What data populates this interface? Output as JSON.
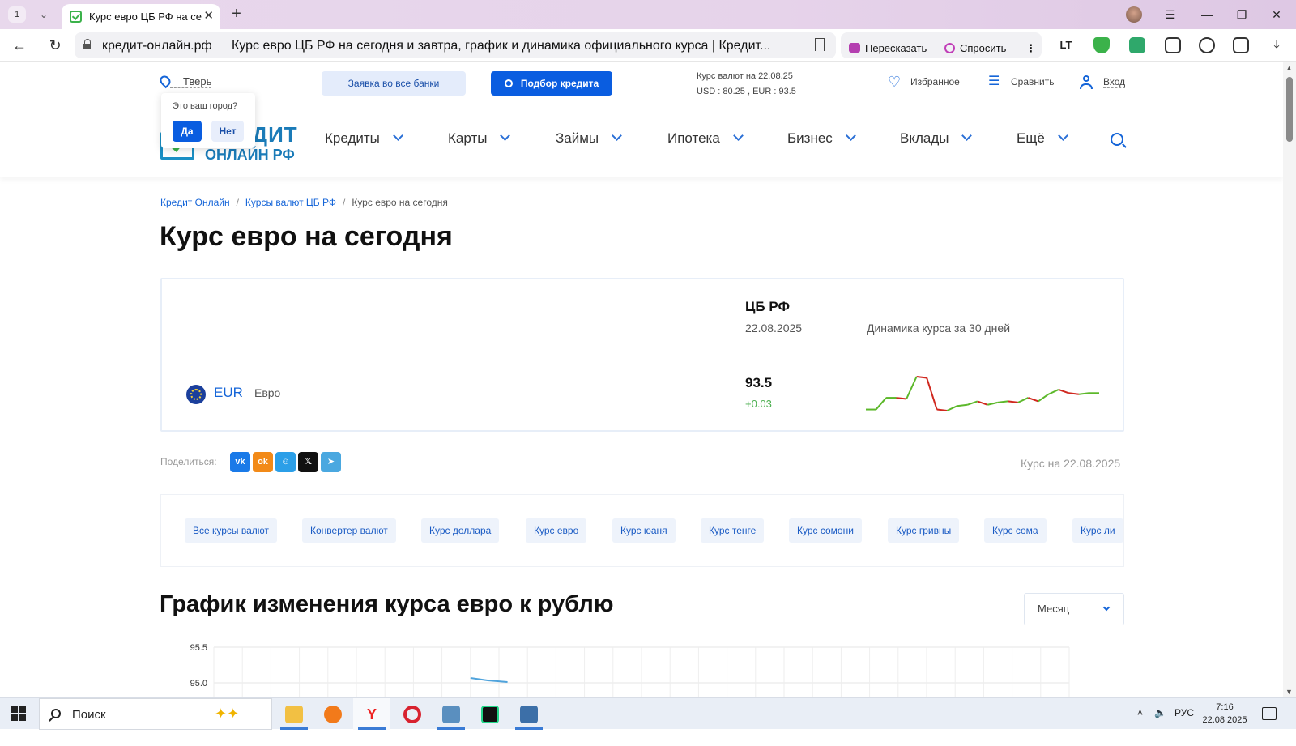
{
  "browser": {
    "tab_count": "1",
    "tab_title": "Курс евро ЦБ РФ на се",
    "url_host": "кредит-онлайн.рф",
    "page_title": "Курс евро ЦБ РФ на сегодня и завтра, график и динамика официального курса | Кредит...",
    "retell_label": "Пересказать",
    "ask_label": "Спросить"
  },
  "topbar": {
    "city": "Тверь",
    "city_question": "Это ваш город?",
    "yes": "Да",
    "no": "Нет",
    "apply_all_banks": "Заявка во все банки",
    "credit_selection": "Подбор кредита",
    "rates_date": "Курс валют на 22.08.25",
    "rates_values": "USD : 80.25 , EUR : 93.5",
    "favorites": "Избранное",
    "compare": "Сравнить",
    "login": "Вход"
  },
  "logo": {
    "line1": "КРЕДИТ",
    "line2": "ОНЛАЙН РФ"
  },
  "nav": [
    {
      "label": "Кредиты"
    },
    {
      "label": "Карты"
    },
    {
      "label": "Займы"
    },
    {
      "label": "Ипотека"
    },
    {
      "label": "Бизнес"
    },
    {
      "label": "Вклады"
    },
    {
      "label": "Ещё"
    }
  ],
  "breadcrumbs": [
    "Кредит Онлайн",
    "Курсы валют ЦБ РФ",
    "Курс евро на сегодня"
  ],
  "page_heading": "Курс евро на сегодня",
  "rate_card": {
    "source": "ЦБ РФ",
    "date": "22.08.2025",
    "dynamics_label": "Динамика курса за 30 дней",
    "currency_code": "EUR",
    "currency_name": "Евро",
    "value": "93.5",
    "change": "+0.03",
    "colors": {
      "up": "#5cb82a",
      "down": "#d0281f"
    }
  },
  "share": {
    "label": "Поделиться:",
    "course_date": "Курс на 22.08.2025"
  },
  "chips": [
    "Все курсы валют",
    "Конвертер валют",
    "Курс доллара",
    "Курс евро",
    "Курс юаня",
    "Курс тенге",
    "Курс сомони",
    "Курс гривны",
    "Курс сома",
    "Курс ли"
  ],
  "chart_section": {
    "heading": "График изменения курса евро к рублю",
    "period": "Месяц"
  },
  "chart_data": {
    "type": "line",
    "title": "",
    "y_ticks": [
      "95.5",
      "95.0"
    ],
    "ylim": [
      95.0,
      95.5
    ],
    "grid": true
  },
  "sparkline": {
    "values": [
      92.4,
      92.4,
      92.9,
      92.9,
      92.85,
      93.8,
      93.75,
      92.4,
      92.35,
      92.55,
      92.6,
      92.75,
      92.6,
      92.7,
      92.75,
      92.7,
      92.9,
      92.75,
      93.05,
      93.25,
      93.1,
      93.05,
      93.1,
      93.1
    ]
  },
  "taskbar": {
    "search_label": "Поиск",
    "lang": "РУС",
    "time": "7:16",
    "date": "22.08.2025"
  }
}
